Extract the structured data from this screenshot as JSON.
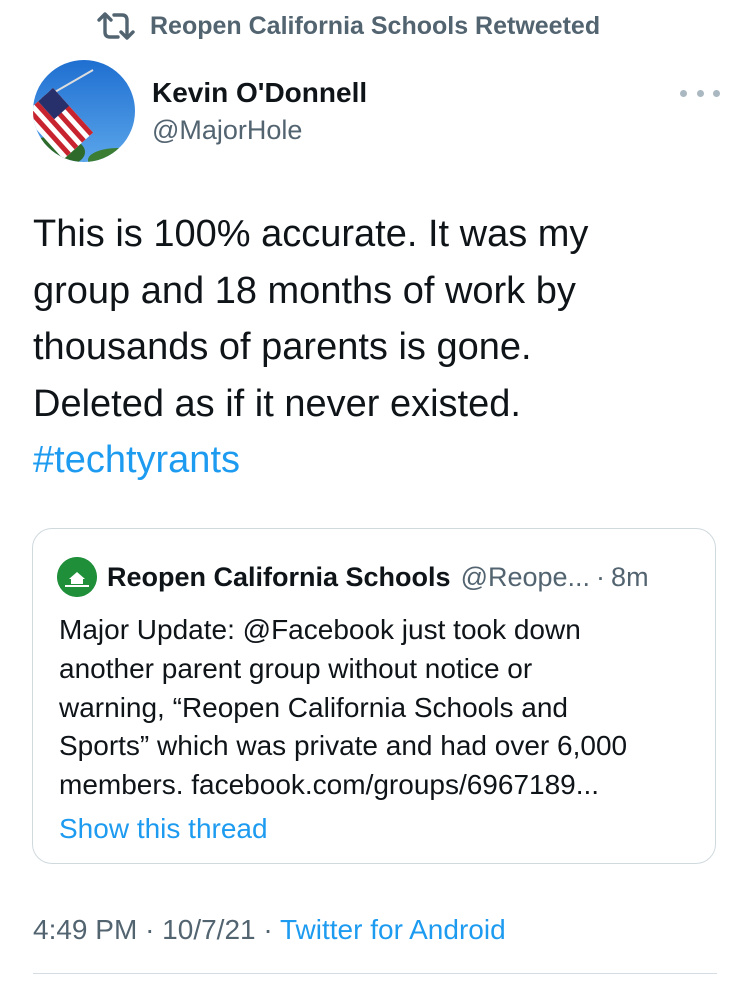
{
  "retweet_header": {
    "icon": "retweet-icon",
    "text": "Reopen California Schools Retweeted"
  },
  "tweet": {
    "author": {
      "name": "Kevin O'Donnell",
      "handle": "@MajorHole",
      "avatar_icon": "american-flag-avatar"
    },
    "text_lines": [
      "This is 100% accurate. It was my",
      "group and 18 months of work by",
      "thousands of parents is gone.",
      "Deleted as if it never existed."
    ],
    "hashtag": "#techtyrants",
    "time": "4:49 PM",
    "date": "10/7/21",
    "separator": "·",
    "source": "Twitter for Android"
  },
  "quoted_tweet": {
    "author_name": "Reopen California Schools",
    "handle": "@Reope...",
    "separator": "·",
    "time": "8m",
    "text_lines": [
      "Major Update: @Facebook just took down",
      "another parent group without notice or",
      "warning, “Reopen California Schools and",
      "Sports” which was private and had over 6,000",
      "members. facebook.com/groups/6967189..."
    ],
    "show_thread": "Show this thread",
    "avatar_color": "#1f8f3a"
  },
  "colors": {
    "accent": "#1d9bf0",
    "secondary_text": "#536471",
    "primary_text": "#0f1419"
  }
}
